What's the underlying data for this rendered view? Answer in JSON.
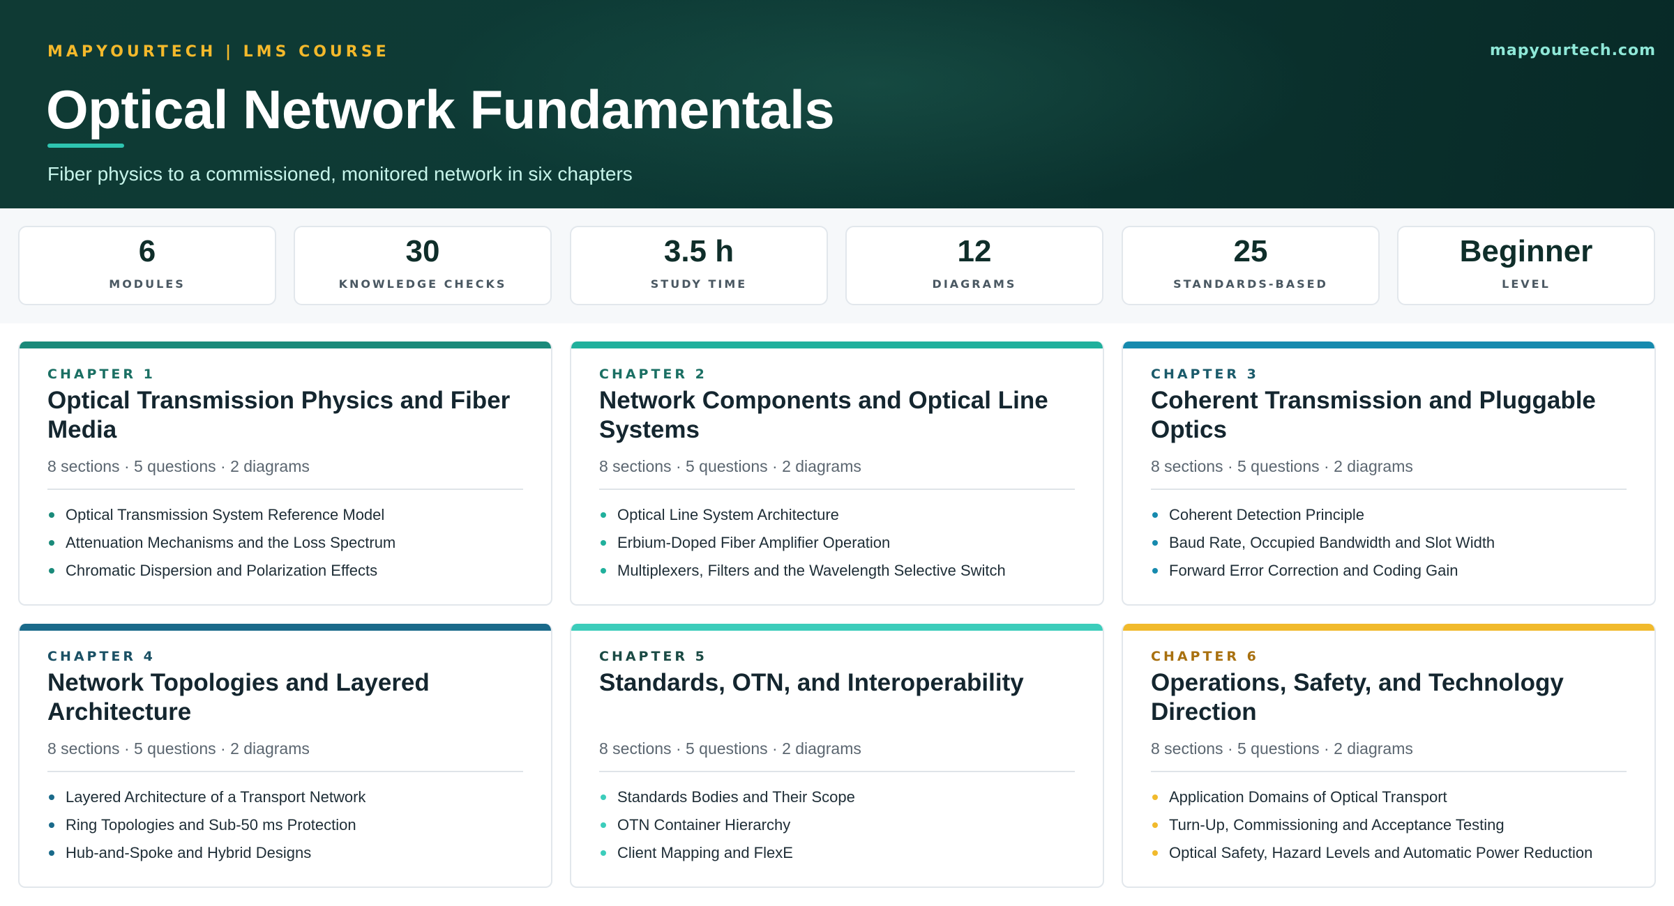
{
  "header": {
    "eyebrow": "MAPYOURTECH | LMS COURSE",
    "site": "mapyourtech.com",
    "title": "Optical Network Fundamentals",
    "subtitle": "Fiber physics to a commissioned, monitored network in six chapters"
  },
  "stats": [
    {
      "value": "6",
      "label": "MODULES"
    },
    {
      "value": "30",
      "label": "KNOWLEDGE CHECKS"
    },
    {
      "value": "3.5 h",
      "label": "STUDY TIME"
    },
    {
      "value": "12",
      "label": "DIAGRAMS"
    },
    {
      "value": "25",
      "label": "STANDARDS-BASED"
    },
    {
      "value": "Beginner",
      "label": "LEVEL"
    }
  ],
  "chapters": [
    {
      "tag": "CHAPTER 1",
      "title": "Optical Transmission Physics and Fiber Media",
      "meta": "8 sections · 5 questions · 2 diagrams",
      "accent": "#1a8a7a",
      "tag_color": "#1a6f63",
      "topics": [
        "Optical Transmission System Reference Model",
        "Attenuation Mechanisms and the Loss Spectrum",
        "Chromatic Dispersion and Polarization Effects"
      ]
    },
    {
      "tag": "CHAPTER 2",
      "title": "Network Components and Optical Line Systems",
      "meta": "8 sections · 5 questions · 2 diagrams",
      "accent": "#20b09c",
      "tag_color": "#1a6f63",
      "topics": [
        "Optical Line System Architecture",
        "Erbium-Doped Fiber Amplifier Operation",
        "Multiplexers, Filters and the Wavelength Selective Switch"
      ]
    },
    {
      "tag": "CHAPTER 3",
      "title": "Coherent Transmission and Pluggable Optics",
      "meta": "8 sections · 5 questions · 2 diagrams",
      "accent": "#168aae",
      "tag_color": "#1a5a6a",
      "topics": [
        "Coherent Detection Principle",
        "Baud Rate, Occupied Bandwidth and Slot Width",
        "Forward Error Correction and Coding Gain"
      ]
    },
    {
      "tag": "CHAPTER 4",
      "title": "Network Topologies and Layered Architecture",
      "meta": "8 sections · 5 questions · 2 diagrams",
      "accent": "#1a6a8a",
      "tag_color": "#1a5064",
      "topics": [
        "Layered Architecture of a Transport Network",
        "Ring Topologies and Sub-50 ms Protection",
        "Hub-and-Spoke and Hybrid Designs"
      ]
    },
    {
      "tag": "CHAPTER 5",
      "title": "Standards, OTN, and Interoperability",
      "meta": "8 sections · 5 questions · 2 diagrams",
      "accent": "#3ccdbb",
      "tag_color": "#1a4a44",
      "topics": [
        "Standards Bodies and Their Scope",
        "OTN Container Hierarchy",
        "Client Mapping and FlexE"
      ]
    },
    {
      "tag": "CHAPTER 6",
      "title": "Operations, Safety, and Technology Direction",
      "meta": "8 sections · 5 questions · 2 diagrams",
      "accent": "#f1ba2c",
      "tag_color": "#a8700f",
      "topics": [
        "Application Domains of Optical Transport",
        "Turn-Up, Commissioning and Acceptance Testing",
        "Optical Safety, Hazard Levels and Automatic Power Reduction"
      ]
    }
  ]
}
